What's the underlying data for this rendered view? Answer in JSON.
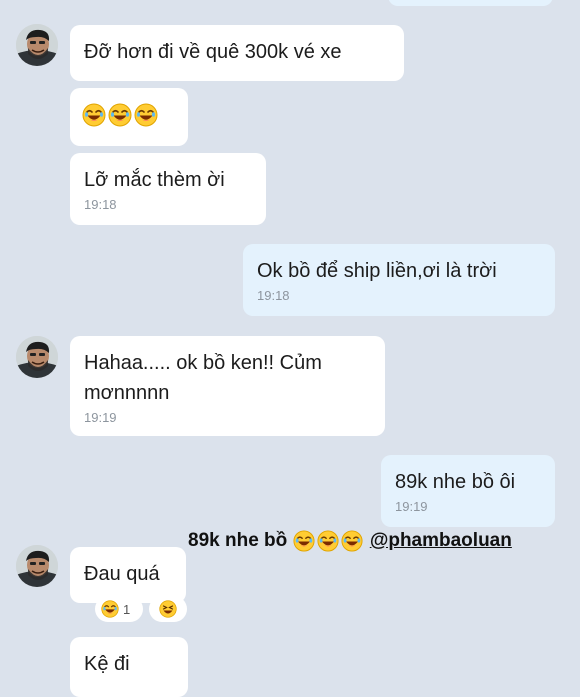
{
  "messages": [
    {
      "id": "m1",
      "direction": "in",
      "text": "Đỡ hơn đi về quê 300k vé xe",
      "time": ""
    },
    {
      "id": "m2",
      "direction": "in",
      "text": "",
      "emoji": [
        "laughing-emoji",
        "laughing-emoji",
        "laughing-emoji"
      ],
      "time": ""
    },
    {
      "id": "m3",
      "direction": "in",
      "text": "Lỡ mắc thèm ời",
      "time": "19:18"
    },
    {
      "id": "m4",
      "direction": "out",
      "text": "Ok bồ để ship liền,ơi là trời",
      "time": "19:18"
    },
    {
      "id": "m5",
      "direction": "in",
      "text": "Hahaa..... ok bồ ken!! Củm\nmơnnnnn",
      "time": "19:19"
    },
    {
      "id": "m6",
      "direction": "out",
      "text": "89k nhe bồ ôi",
      "time": "19:19"
    },
    {
      "id": "m7",
      "direction": "in",
      "text": "Đau quá",
      "time": "",
      "reactions": [
        {
          "icon": "laughing-emoji",
          "count": "1"
        },
        {
          "icon": "haha-emoji",
          "count": ""
        }
      ]
    },
    {
      "id": "m8",
      "direction": "in",
      "text": "Kệ đi",
      "time": ""
    }
  ],
  "caption": {
    "text": "89k nhe bồ",
    "emoji": [
      "laughing-emoji",
      "laughing-emoji",
      "laughing-emoji"
    ],
    "mention": "@phambaoluan"
  },
  "colors": {
    "background": "#dbe2ec",
    "incoming_bubble": "#ffffff",
    "outgoing_bubble": "#e4f2fd",
    "time_text": "#8d959e"
  }
}
